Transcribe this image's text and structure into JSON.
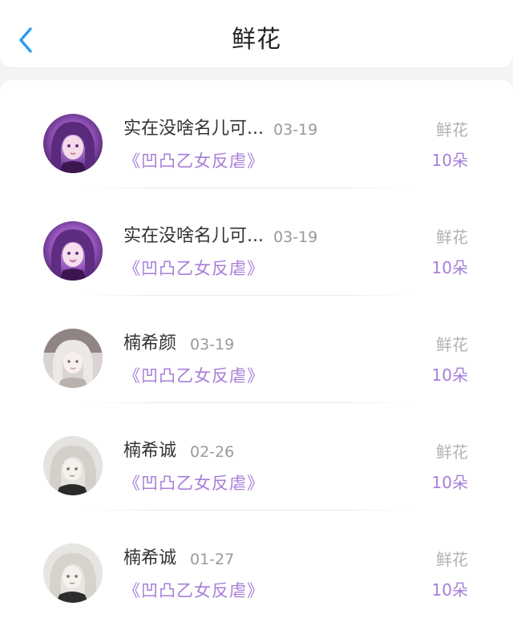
{
  "header": {
    "title": "鲜花",
    "back_icon": "chevron-left-icon",
    "accent_color": "#2a9cf0"
  },
  "list": {
    "items": [
      {
        "name": "实在没啥名儿可...",
        "date": "03-19",
        "book": "《凹凸乙女反虐》",
        "gift_type": "鲜花",
        "gift_count": "10朵",
        "avatar": "purple-anime-avatar"
      },
      {
        "name": "实在没啥名儿可...",
        "date": "03-19",
        "book": "《凹凸乙女反虐》",
        "gift_type": "鲜花",
        "gift_count": "10朵",
        "avatar": "purple-anime-avatar"
      },
      {
        "name": "楠希颜",
        "date": "03-19",
        "book": "《凹凸乙女反虐》",
        "gift_type": "鲜花",
        "gift_count": "10朵",
        "avatar": "grey-anime-avatar"
      },
      {
        "name": "楠希诚",
        "date": "02-26",
        "book": "《凹凸乙女反虐》",
        "gift_type": "鲜花",
        "gift_count": "10朵",
        "avatar": "grey-anime-avatar"
      },
      {
        "name": "楠希诚",
        "date": "01-27",
        "book": "《凹凸乙女反虐》",
        "gift_type": "鲜花",
        "gift_count": "10朵",
        "avatar": "grey-anime-avatar"
      }
    ]
  },
  "colors": {
    "book_title": "#a77ed8",
    "gift_count": "#a77ed8",
    "gift_type": "#b2b2b2",
    "date": "#9a9a9a"
  }
}
